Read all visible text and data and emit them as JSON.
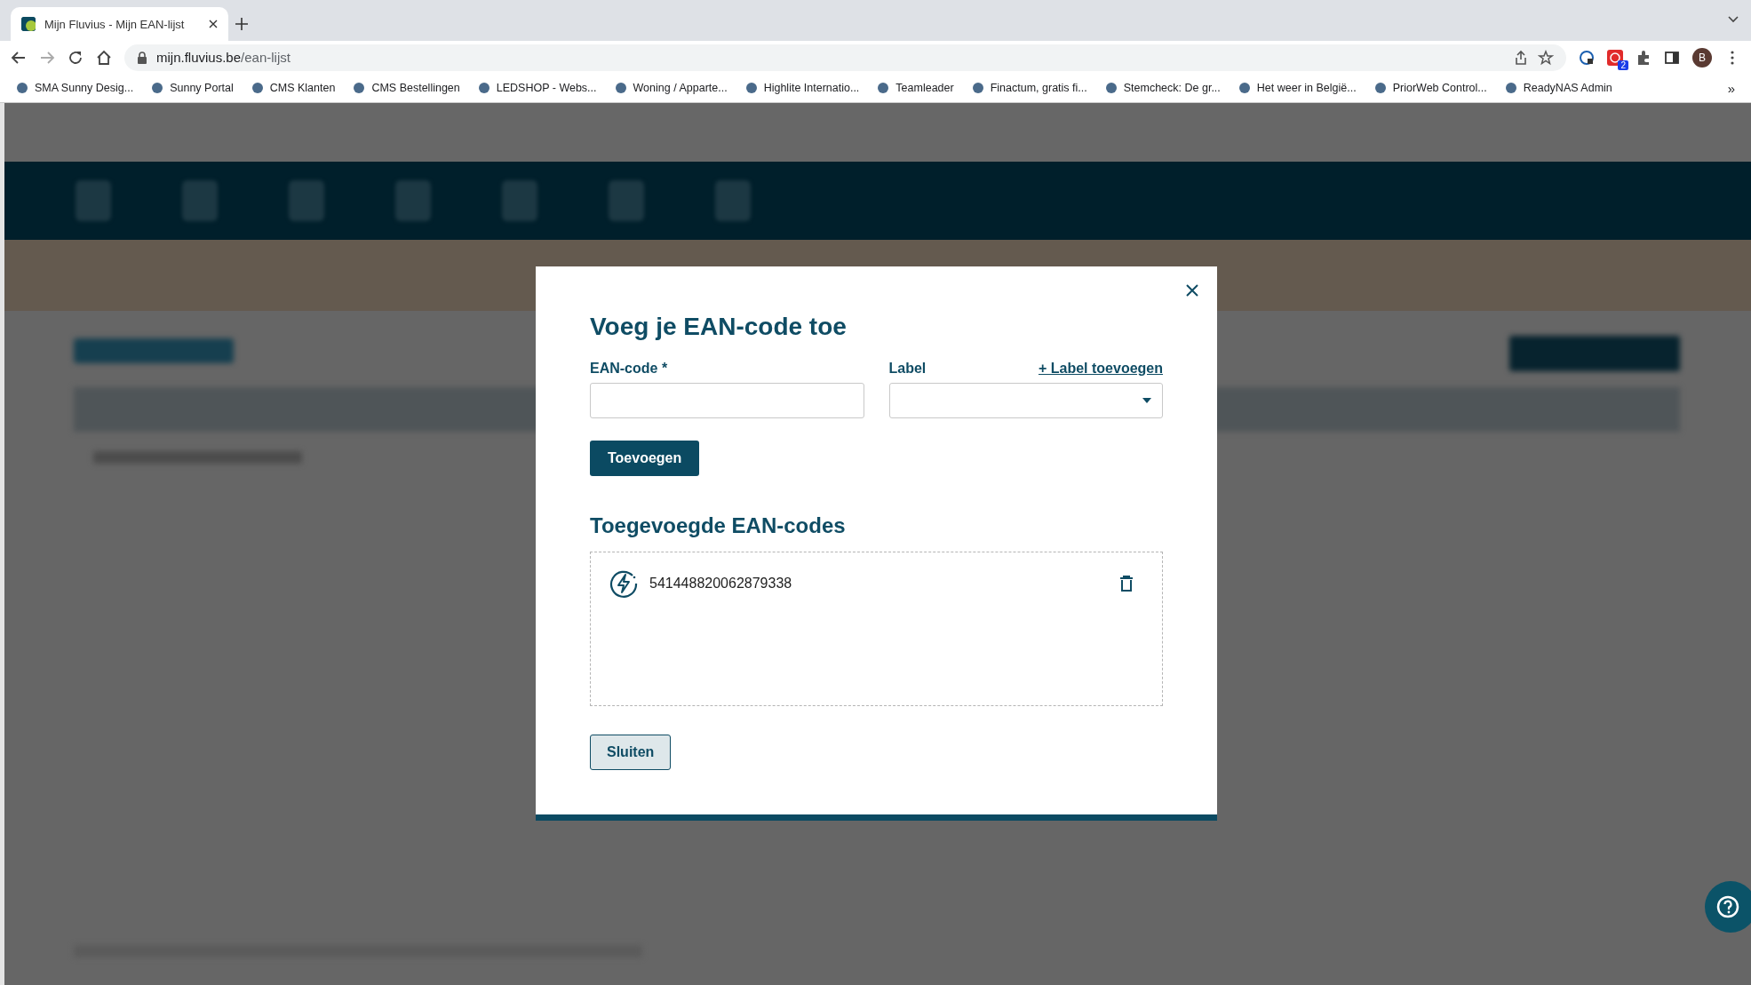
{
  "browser": {
    "tab": {
      "title": "Mijn Fluvius - Mijn EAN-lijst",
      "selected": true
    },
    "address": {
      "host": "mijn.fluvius.be",
      "path": "/ean-lijst"
    },
    "extension_badge": "2",
    "profile_initial": "B",
    "bookmarks": [
      "SMA Sunny Desig...",
      "Sunny Portal",
      "CMS Klanten",
      "CMS Bestellingen",
      "LEDSHOP - Webs...",
      "Woning / Apparte...",
      "Highlite Internatio...",
      "Teamleader",
      "Finactum, gratis fi...",
      "Stemcheck: De gr...",
      "Het weer in België...",
      "PriorWeb Control...",
      "ReadyNAS Admin"
    ],
    "bookmarks_overflow": "»"
  },
  "modal": {
    "title": "Voeg je EAN-code toe",
    "ean_field": {
      "label": "EAN-code *"
    },
    "label_field": {
      "label": "Label",
      "link": "+ Label toevoegen"
    },
    "add_button": "Toevoegen",
    "list_heading": "Toegevoegde EAN-codes",
    "entries": [
      {
        "code": "541448820062879338"
      }
    ],
    "close_button": "Sluiten"
  }
}
